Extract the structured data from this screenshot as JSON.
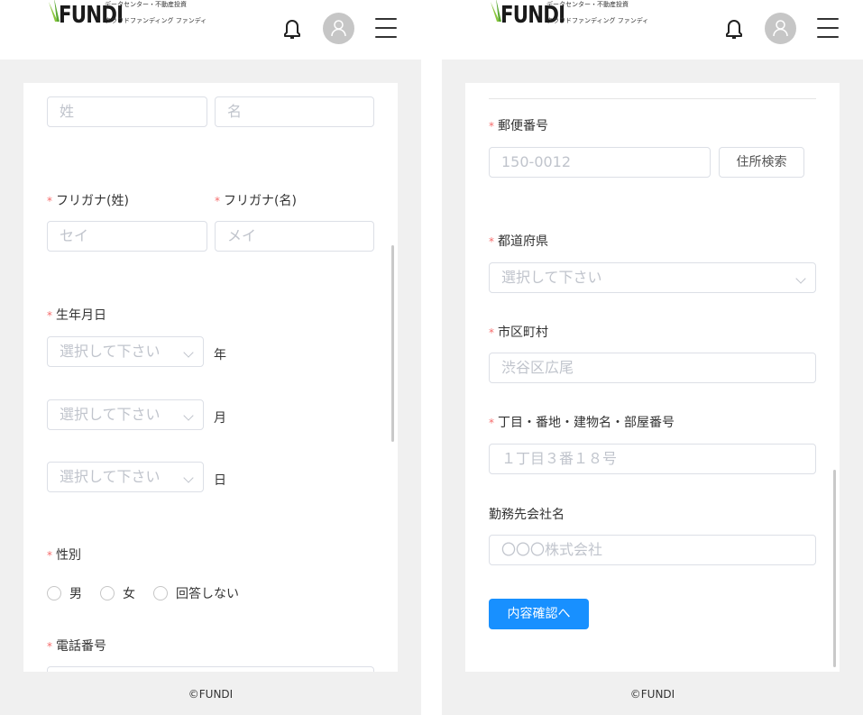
{
  "logo": {
    "word": "FUNDI",
    "sub1": "データセンター・不動産投資",
    "sub2": "クラウドファンディング ファンディ"
  },
  "colors": {
    "accent": "#1890ff",
    "required": "#f56c6c",
    "background": "#f0f0f0"
  },
  "icons": {
    "bell": "bell-icon",
    "avatar": "user-avatar-icon",
    "menu": "hamburger-menu-icon",
    "chevron": "chevron-down-icon"
  },
  "left": {
    "name": {
      "last_placeholder": "姓",
      "first_placeholder": "名"
    },
    "kana": {
      "req": "*",
      "last_label": "フリガナ(姓)",
      "first_label": "フリガナ(名)",
      "last_placeholder": "セイ",
      "first_placeholder": "メイ"
    },
    "birth": {
      "req": "*",
      "label": "生年月日",
      "year_placeholder": "選択して下さい",
      "year_unit": "年",
      "month_placeholder": "選択して下さい",
      "month_unit": "月",
      "day_placeholder": "選択して下さい",
      "day_unit": "日"
    },
    "gender": {
      "req": "*",
      "label": "性別",
      "options": [
        "男",
        "女",
        "回答しない"
      ]
    },
    "phone": {
      "req": "*",
      "label": "電話番号"
    },
    "footer": "©FUNDI"
  },
  "right": {
    "postal": {
      "req": "*",
      "label": "郵便番号",
      "placeholder": "150-0012",
      "search_button": "住所検索"
    },
    "prefecture": {
      "req": "*",
      "label": "都道府県",
      "placeholder": "選択して下さい"
    },
    "city": {
      "req": "*",
      "label": "市区町村",
      "placeholder": "渋谷区広尾"
    },
    "address": {
      "req": "*",
      "label": "丁目・番地・建物名・部屋番号",
      "placeholder": "１丁目３番１８号"
    },
    "company": {
      "label": "勤務先会社名",
      "placeholder": "〇〇〇株式会社"
    },
    "confirm_button": "内容確認へ",
    "footer": "©FUNDI"
  }
}
